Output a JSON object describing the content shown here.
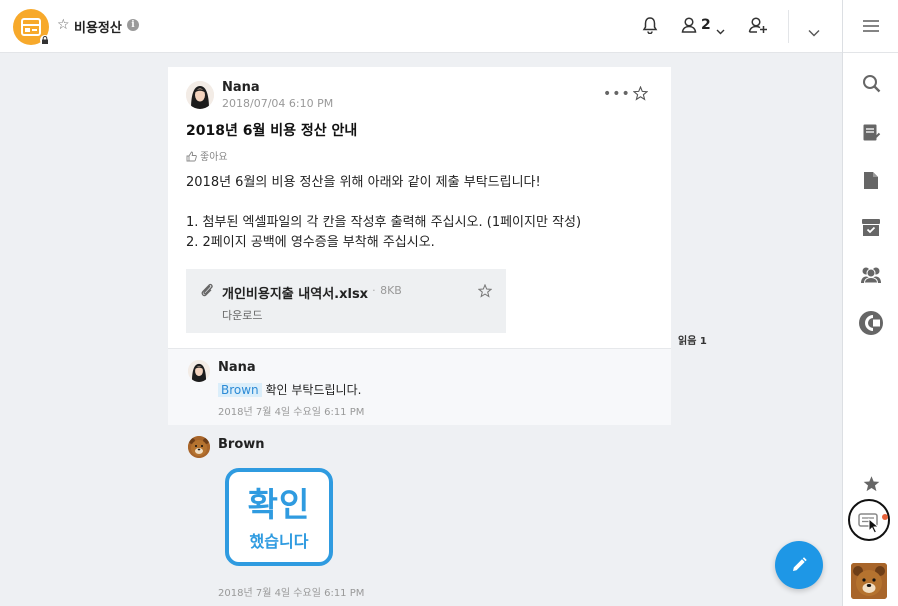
{
  "header": {
    "room_title": "비용정산",
    "member_count": "2",
    "icons": [
      "room-logo-icon",
      "star-icon",
      "info-icon",
      "bell-icon",
      "member-icon",
      "chevron-down-icon",
      "add-member-icon",
      "chevron-down-icon"
    ]
  },
  "post": {
    "author": "Nana",
    "date": "2018/07/04 6:10 PM",
    "title": "2018년 6월 비용 정산 안내",
    "like_label": "좋아요",
    "body": {
      "line1": "2018년 6월의 비용 정산을 위해 아래와 같이 제출 부탁드립니다!",
      "line2": "1. 첨부된 엑셀파일의 각 칸을 작성후 출력해 주십시오. (1페이지만 작성)",
      "line3": "2. 2페이지 공백에 영수증을 부착해 주십시오."
    },
    "attachment": {
      "name": "개인비용지출 내역서.xlsx",
      "size": "8KB",
      "download_label": "다운로드"
    },
    "read_label": "읽음 1"
  },
  "comments": [
    {
      "author": "Nana",
      "mention": "Brown",
      "text": "확인 부탁드립니다.",
      "date": "2018년 7월 4일 수요일   6:11 PM"
    },
    {
      "author": "Brown",
      "sticker_big": "확인",
      "sticker_small": "했습니다",
      "date": "2018년 7월 4일 수요일   6:11 PM"
    }
  ],
  "sidebar": {
    "icons": [
      "menu-icon",
      "search-icon",
      "task-icon",
      "file-icon",
      "archive-icon",
      "members-icon",
      "calendar-icon",
      "star-icon",
      "chat-icon"
    ]
  },
  "colors": {
    "accent": "#1e97e6",
    "room_logo": "#f7a92b",
    "mention_bg": "#dbeefa"
  }
}
